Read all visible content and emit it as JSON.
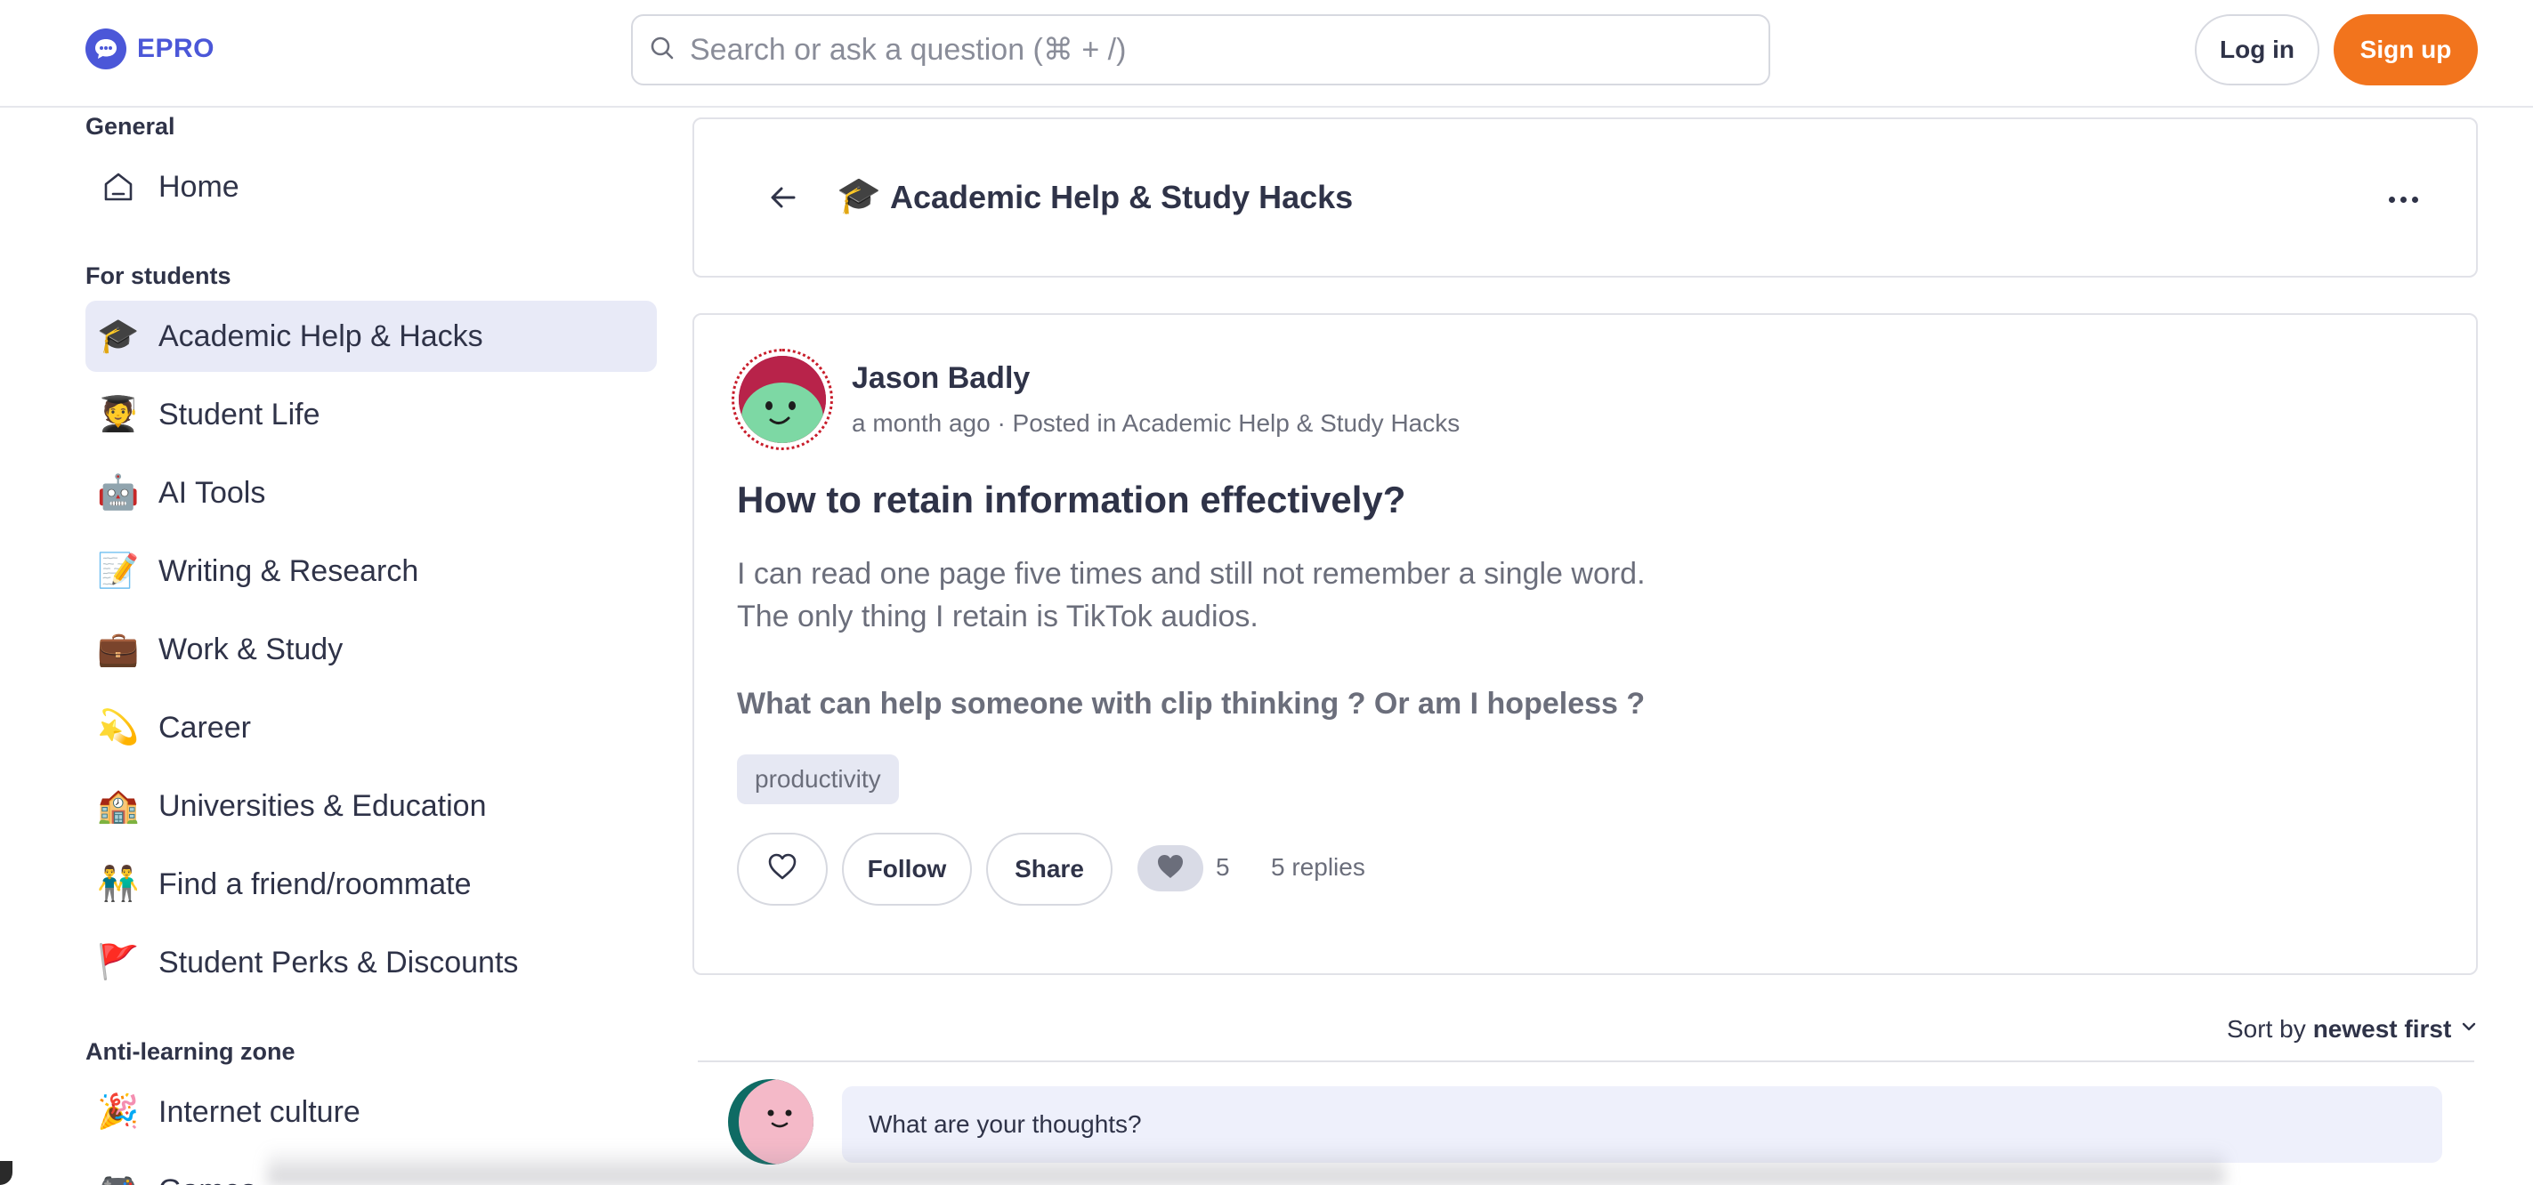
{
  "brand": {
    "name": "EPRO",
    "accent": "#4b57d8",
    "signup_color": "#f2741d"
  },
  "header": {
    "search_placeholder": "Search or ask a question (⌘ + /)",
    "login_label": "Log in",
    "signup_label": "Sign up"
  },
  "sidebar": {
    "sections": [
      {
        "title": "General",
        "items": [
          {
            "label": "Home",
            "icon": "home-icon"
          }
        ]
      },
      {
        "title": "For students",
        "items": [
          {
            "label": "Academic Help & Hacks",
            "icon": "graduation-cap-icon",
            "emoji": "🎓",
            "active": true
          },
          {
            "label": "Student Life",
            "icon": "student-icon",
            "emoji": "🧑‍🎓"
          },
          {
            "label": "AI Tools",
            "icon": "robot-icon",
            "emoji": "🤖"
          },
          {
            "label": "Writing & Research",
            "icon": "memo-icon",
            "emoji": "📝"
          },
          {
            "label": "Work & Study",
            "icon": "briefcase-icon",
            "emoji": "💼"
          },
          {
            "label": "Career",
            "icon": "dizzy-star-icon",
            "emoji": "💫"
          },
          {
            "label": "Universities & Education",
            "icon": "school-icon",
            "emoji": "🏫"
          },
          {
            "label": "Find a friend/roommate",
            "icon": "two-people-icon",
            "emoji": "👬"
          },
          {
            "label": "Student Perks & Discounts",
            "icon": "red-flag-icon",
            "emoji": "🚩"
          }
        ]
      },
      {
        "title": "Anti-learning zone",
        "items": [
          {
            "label": "Internet culture",
            "icon": "party-popper-icon",
            "emoji": "🎉"
          },
          {
            "label": "Games",
            "icon": "game-controller-icon",
            "emoji": "🎮"
          }
        ]
      }
    ]
  },
  "topic": {
    "emoji": "🎓",
    "title": "Academic Help & Study Hacks"
  },
  "post": {
    "author": "Jason Badly",
    "meta": "a month ago · Posted in Academic Help & Study Hacks",
    "title": "How to retain information effectively?",
    "body_lines": [
      "I can read one page five times and still not remember a single word.",
      "The only thing I retain is TikTok audios."
    ],
    "question": "What can help someone with clip thinking ? Or am I hopeless ?",
    "tag": "productivity",
    "follow_label": "Follow",
    "share_label": "Share",
    "like_count": "5",
    "replies": "5 replies"
  },
  "comments": {
    "sort_prefix": "Sort by",
    "sort_value": "newest first",
    "composer_placeholder": "What are your thoughts?"
  }
}
